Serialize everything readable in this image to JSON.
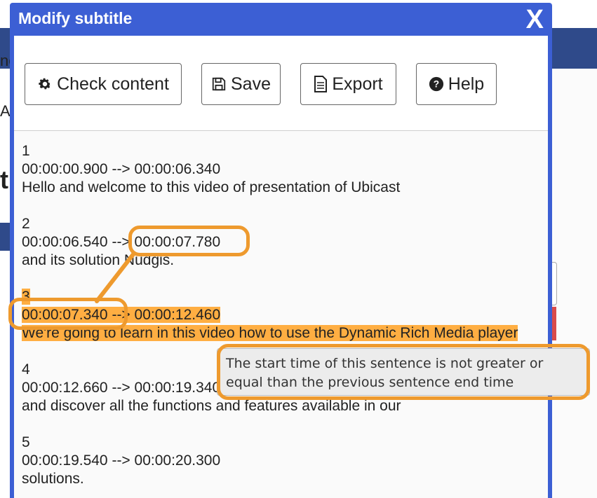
{
  "background": {
    "fragments": [
      "ne",
      "Ac",
      "t"
    ]
  },
  "modal": {
    "title": "Modify subtitle",
    "close_label": "X",
    "toolbar": {
      "check_content_label": "Check content",
      "save_label": "Save",
      "export_label": "Export",
      "help_label": "Help"
    },
    "subtitles": [
      {
        "index": "1",
        "timing": "00:00:00.900 --> 00:00:06.340",
        "text": "Hello and welcome to this video of presentation of Ubicast"
      },
      {
        "index": "2",
        "timing": "00:00:06.540 --> 00:00:07.780",
        "text": " and its solution  Nudgis."
      },
      {
        "index": "3",
        "timing": "00:00:07.340 --> 00:00:12.460",
        "text": "We're going to learn in this video how to use the Dynamic  Rich Media player"
      },
      {
        "index": "4",
        "timing": "00:00:12.660 --> 00:00:19.340",
        "text": "and discover all the functions and features available in our"
      },
      {
        "index": "5",
        "timing": "00:00:19.540 --> 00:00:20.300",
        "text": "solutions."
      }
    ],
    "tooltip": "The start time of this sentence is not greater or equal than the previous sentence end time"
  },
  "colors": {
    "modal_header": "#3c5fd4",
    "highlight": "#ffae42",
    "annotation": "#ee9a2e"
  }
}
